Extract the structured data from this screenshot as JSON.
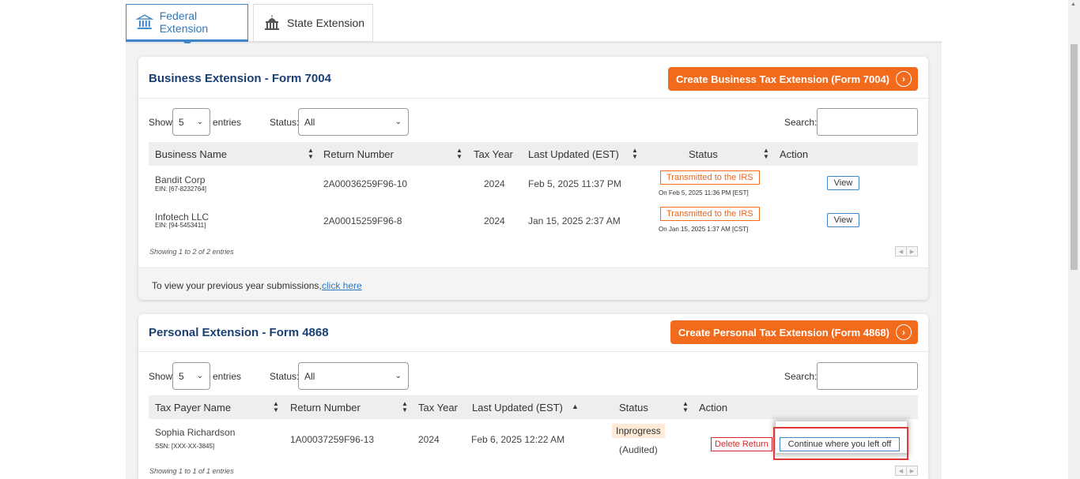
{
  "tabs": [
    {
      "label": "Federal Extension",
      "active": true,
      "icon": "bank-icon"
    },
    {
      "label": "State Extension",
      "active": false,
      "icon": "capitol-icon"
    }
  ],
  "colors": {
    "accent": "#f26a1b",
    "title": "#1a3f73",
    "tab_active": "#3a86c8"
  },
  "business": {
    "title": "Business Extension - Form 7004",
    "create_label": "Create Business Tax Extension (Form 7004)",
    "show_label": "Show",
    "page_size": "5",
    "entries_label": "entries",
    "status_label": "Status:",
    "status_value": "All",
    "search_label": "Search:",
    "columns": [
      "Business Name",
      "Return Number",
      "Tax Year",
      "Last Updated (EST)",
      "Status",
      "Action"
    ],
    "rows": [
      {
        "name": "Bandit Corp",
        "ein": "EIN: [67-8232764]",
        "return_number": "2A00036259F96-10",
        "tax_year": "2024",
        "updated": "Feb 5, 2025 11:37 PM",
        "status": "Transmitted to the IRS",
        "status_sub": "On Feb 5, 2025 11:36 PM [EST]",
        "action": "View"
      },
      {
        "name": "Infotech LLC",
        "ein": "EIN: [94-5453411]",
        "return_number": "2A00015259F96-8",
        "tax_year": "2024",
        "updated": "Jan 15, 2025 2:37 AM",
        "status": "Transmitted to the IRS",
        "status_sub": "On Jan 15, 2025 1:37 AM [CST]",
        "action": "View"
      }
    ],
    "showing": "Showing 1 to 2 of 2 entries",
    "prev_text": "To view your previous year submissions,",
    "prev_link": "click here"
  },
  "personal": {
    "title": "Personal Extension - Form 4868",
    "create_label": "Create Personal Tax Extension (Form 4868)",
    "show_label": "Show",
    "page_size": "5",
    "entries_label": "entries",
    "status_label": "Status:",
    "status_value": "All",
    "search_label": "Search:",
    "columns": [
      "Tax Payer Name",
      "Return Number",
      "Tax Year",
      "Last Updated (EST)",
      "Status",
      "Action"
    ],
    "rows": [
      {
        "name": "Sophia Richardson",
        "ssn": "SSN: [XXX-XX-3845]",
        "return_number": "1A00037259F96-13",
        "tax_year": "2024",
        "updated": "Feb 6, 2025 12:22 AM",
        "status": "Inprogress",
        "status_sub": "(Audited)",
        "delete": "Delete Return",
        "continue": "Continue where you left off"
      }
    ],
    "showing": "Showing 1 to 1 of 1 entries"
  }
}
